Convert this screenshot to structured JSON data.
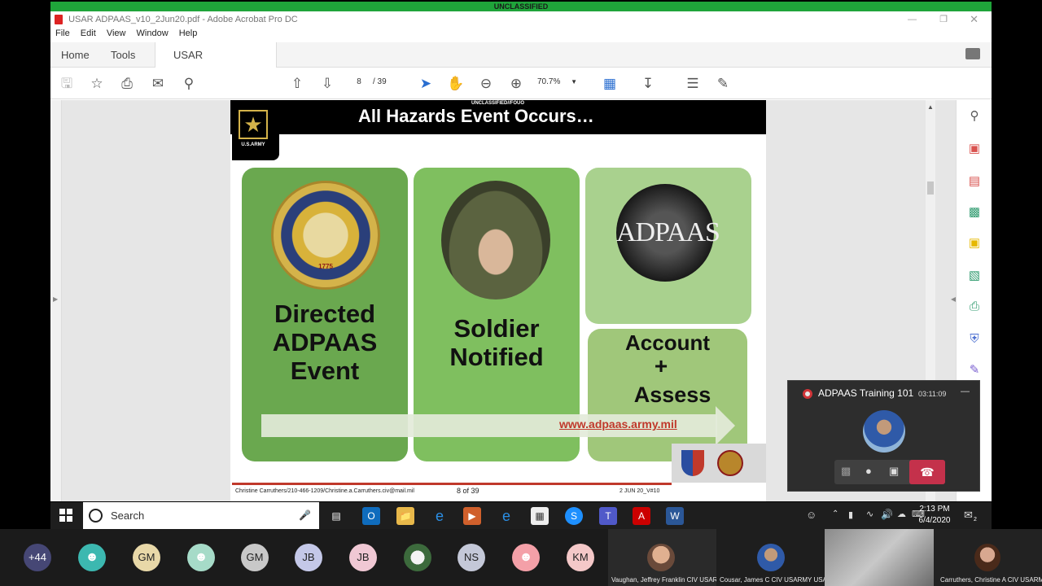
{
  "classification": "UNCLASSIFIED",
  "window": {
    "title": "USAR ADPAAS_v10_2Jun20.pdf - Adobe Acrobat Pro DC"
  },
  "menu": [
    "File",
    "Edit",
    "View",
    "Window",
    "Help"
  ],
  "tabs": {
    "home": "Home",
    "tools": "Tools",
    "document": "USAR ADPAAS_v10..."
  },
  "toolbar": {
    "page_current": "8",
    "page_total": "/ 39",
    "zoom": "70.7%"
  },
  "slide": {
    "marking": "UNCLASSIFIED//FOUO",
    "title": "All Hazards Event Occurs…",
    "army_logo_text": "U.S.ARMY",
    "seal_text": "DEPARTMENT OF THE ARMY · UNITED STATES OF AMERICA",
    "seal_year": "1775",
    "adpaas_logo": "ADPAAS",
    "box1": [
      "Directed",
      "ADPAAS",
      "Event"
    ],
    "box2": [
      "Soldier",
      "Notified"
    ],
    "box3": {
      "line1": "Account",
      "plus": "+",
      "line2": "Assess"
    },
    "url": "www.adpaas.army.mil",
    "footer_contact": "Christine Carruthers/210-466-1209/Christine.a.Carruthers.civ@mail.mil",
    "footer_page": "8 of 39",
    "footer_date": "2 JUN 20_V#10"
  },
  "call": {
    "title": "ADPAAS Training 101",
    "duration": "03:11:09"
  },
  "taskbar": {
    "search": "Search",
    "time": "2:13 PM",
    "date": "6/4/2020",
    "notif_count": "2"
  },
  "meeting": {
    "overflow": "+44",
    "avatars": [
      "GM",
      "GM",
      "JB",
      "JB",
      "NS",
      "KM"
    ],
    "videos": [
      "Vaughan, Jeffrey Franklin CIV USAR...",
      "Cousar, James C CIV USARMY USAR...",
      "Carruthers, Christine A CIV USARM..."
    ]
  },
  "colors": {
    "class_green": "#1fa43a",
    "panel_dark": "#6aa84f",
    "panel_mid": "#7fbf5f",
    "panel_light": "#a9d18e",
    "hangup": "#c4314b",
    "url": "#c0392b"
  }
}
